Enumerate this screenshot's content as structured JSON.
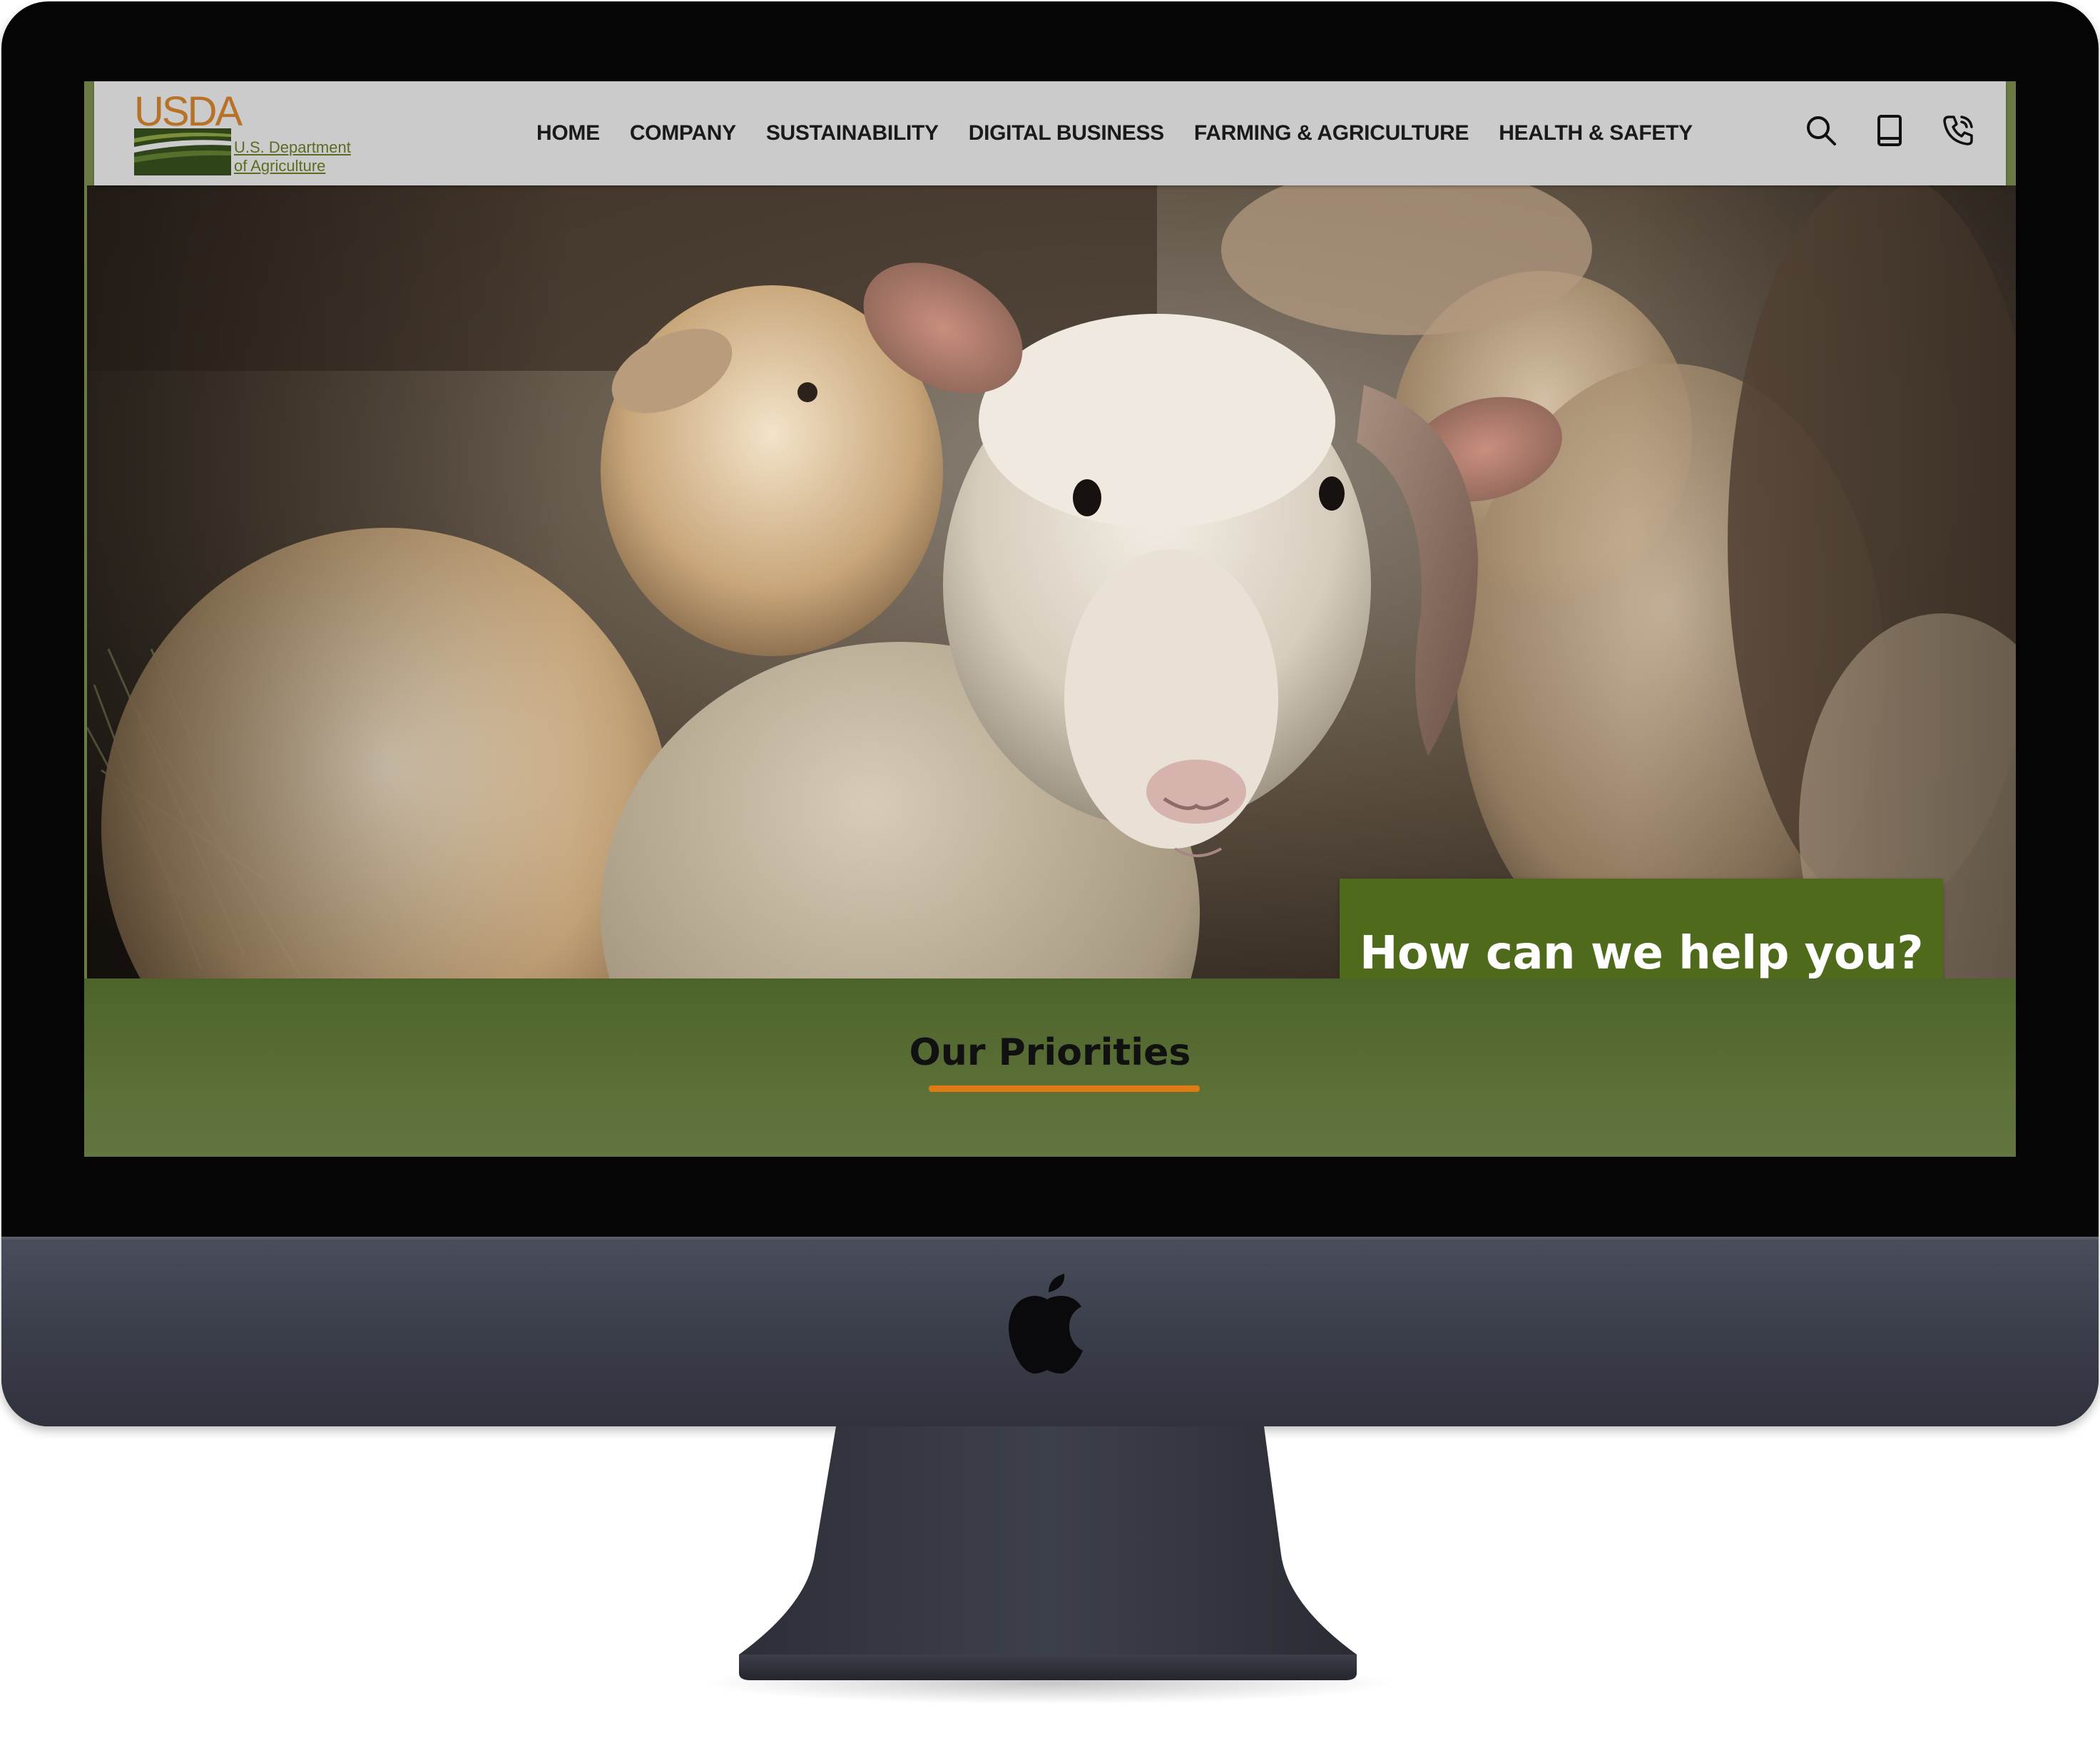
{
  "header": {
    "logo": {
      "wordmark": "USDA",
      "subtitle_line1": "U.S. Department",
      "subtitle_line2": "of Agriculture"
    },
    "nav": [
      {
        "label": "HOME"
      },
      {
        "label": "COMPANY"
      },
      {
        "label": "SUSTAINABILITY"
      },
      {
        "label": "DIGITAL BUSINESS"
      },
      {
        "label": "FARMING & AGRICULTURE"
      },
      {
        "label": "HEALTH & SAFETY"
      }
    ],
    "icons": [
      "search-icon",
      "book-icon",
      "phone-icon"
    ]
  },
  "hero": {
    "image": "sheep-flock-photo",
    "cta_label": "How can we help you?"
  },
  "priorities": {
    "title": "Our Priorities"
  },
  "colors": {
    "header_bg": "#cbcbcb",
    "brand_orange": "#b77227",
    "brand_green": "#4f6a1b",
    "band_green": "#5b6f37",
    "accent_orange": "#e07a12"
  }
}
